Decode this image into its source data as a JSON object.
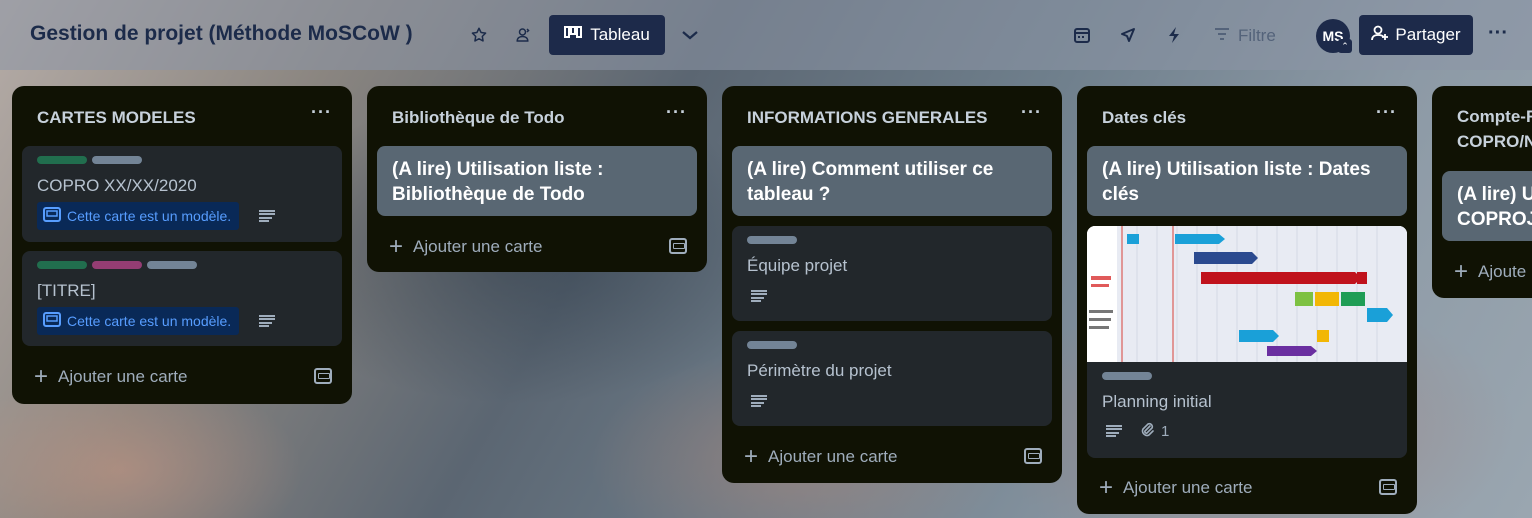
{
  "header": {
    "board_title": "Gestion de projet (Méthode MoSCoW )",
    "view_label": "Tableau",
    "filter_label": "Filtre",
    "avatar_initials": "MS",
    "share_label": "Partager",
    "icons": [
      "star-icon",
      "people-icon",
      "board-icon",
      "chevron-down-icon",
      "calendar-icon",
      "rocket-icon",
      "lightning-icon",
      "filter-icon",
      "more-icon"
    ]
  },
  "colors": {
    "header_bg": "#8c96a5",
    "list_bg": "#101204",
    "card_bg": "#22272b",
    "card_light_bg": "#596773",
    "label_green": "#216e4e",
    "label_gray": "#738496",
    "label_pink": "#943d73",
    "navy": "#1d2a4a",
    "template_blue": "#579dff"
  },
  "lists": [
    {
      "title": "CARTES MODELES",
      "cards": [
        {
          "title": "COPRO XX/XX/2020",
          "labels": [
            "green",
            "gray"
          ],
          "template_badge": "Cette carte est un modèle.",
          "has_description": true
        },
        {
          "title": "[TITRE]",
          "labels": [
            "green",
            "pink",
            "gray"
          ],
          "template_badge": "Cette carte est un modèle.",
          "has_description": true
        }
      ],
      "add_label": "Ajouter une carte"
    },
    {
      "title": "Bibliothèque de Todo",
      "cards": [
        {
          "title": "(A lire) Utilisation liste : Bibliothèque de Todo"
        }
      ],
      "add_label": "Ajouter une carte"
    },
    {
      "title": "INFORMATIONS GENERALES",
      "cards": [
        {
          "title": "(A lire) Comment utiliser ce tableau ?"
        },
        {
          "title": "Équipe projet",
          "labels": [
            "gray"
          ],
          "has_description": true
        },
        {
          "title": "Périmètre du projet",
          "labels": [
            "gray"
          ],
          "has_description": true
        }
      ],
      "add_label": "Ajouter une carte"
    },
    {
      "title": "Dates clés",
      "cards": [
        {
          "title": "(A lire) Utilisation liste : Dates clés"
        },
        {
          "title": "Planning initial",
          "labels": [
            "gray"
          ],
          "has_description": true,
          "attachments": "1"
        }
      ],
      "add_label": "Ajouter une carte"
    },
    {
      "title": "Compte-R",
      "title_line2": "COPRO/N",
      "cards": [
        {
          "title": "(A lire) U",
          "title_line2": "COPROJ,"
        }
      ],
      "add_label": "Ajoute"
    }
  ]
}
